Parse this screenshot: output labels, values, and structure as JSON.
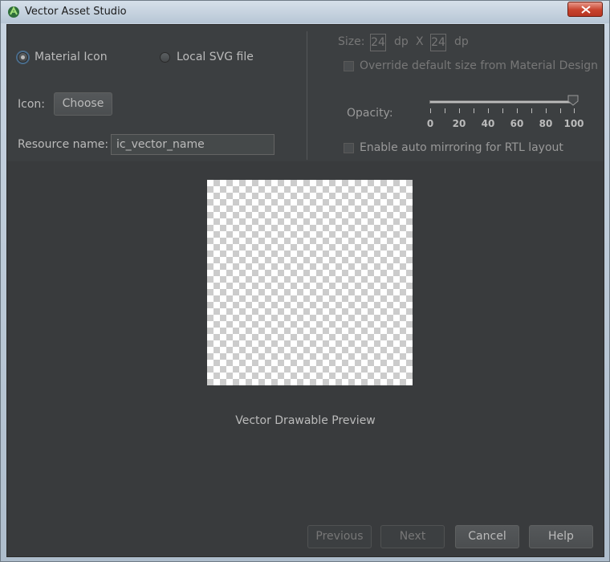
{
  "window": {
    "title": "Vector Asset Studio"
  },
  "source": {
    "material_label": "Material Icon",
    "local_svg_label": "Local SVG file",
    "selected": "Material Icon"
  },
  "icon": {
    "label": "Icon:",
    "choose_label": "Choose"
  },
  "resource": {
    "label": "Resource name:",
    "value": "ic_vector_name"
  },
  "size": {
    "label": "Size:",
    "width": "24",
    "height": "24",
    "unit": "dp",
    "separator": "X",
    "override_label": "Override default size from Material Design",
    "override_checked": false
  },
  "opacity": {
    "label": "Opacity:",
    "value": 100,
    "ticks": [
      "0",
      "20",
      "40",
      "60",
      "80",
      "100"
    ]
  },
  "rtl": {
    "label": "Enable auto mirroring for RTL layout",
    "checked": false
  },
  "preview": {
    "caption": "Vector Drawable Preview"
  },
  "footer": {
    "previous_label": "Previous",
    "next_label": "Next",
    "cancel_label": "Cancel",
    "help_label": "Help"
  },
  "icons": {
    "app": "android-studio-icon",
    "close": "close-icon",
    "slider": "slider-thumb-icon"
  },
  "colors": {
    "panel": "#3c3f41",
    "text": "#bbbbbb",
    "disabled_text": "#777777",
    "radio_focus": "#4a6d8c"
  }
}
